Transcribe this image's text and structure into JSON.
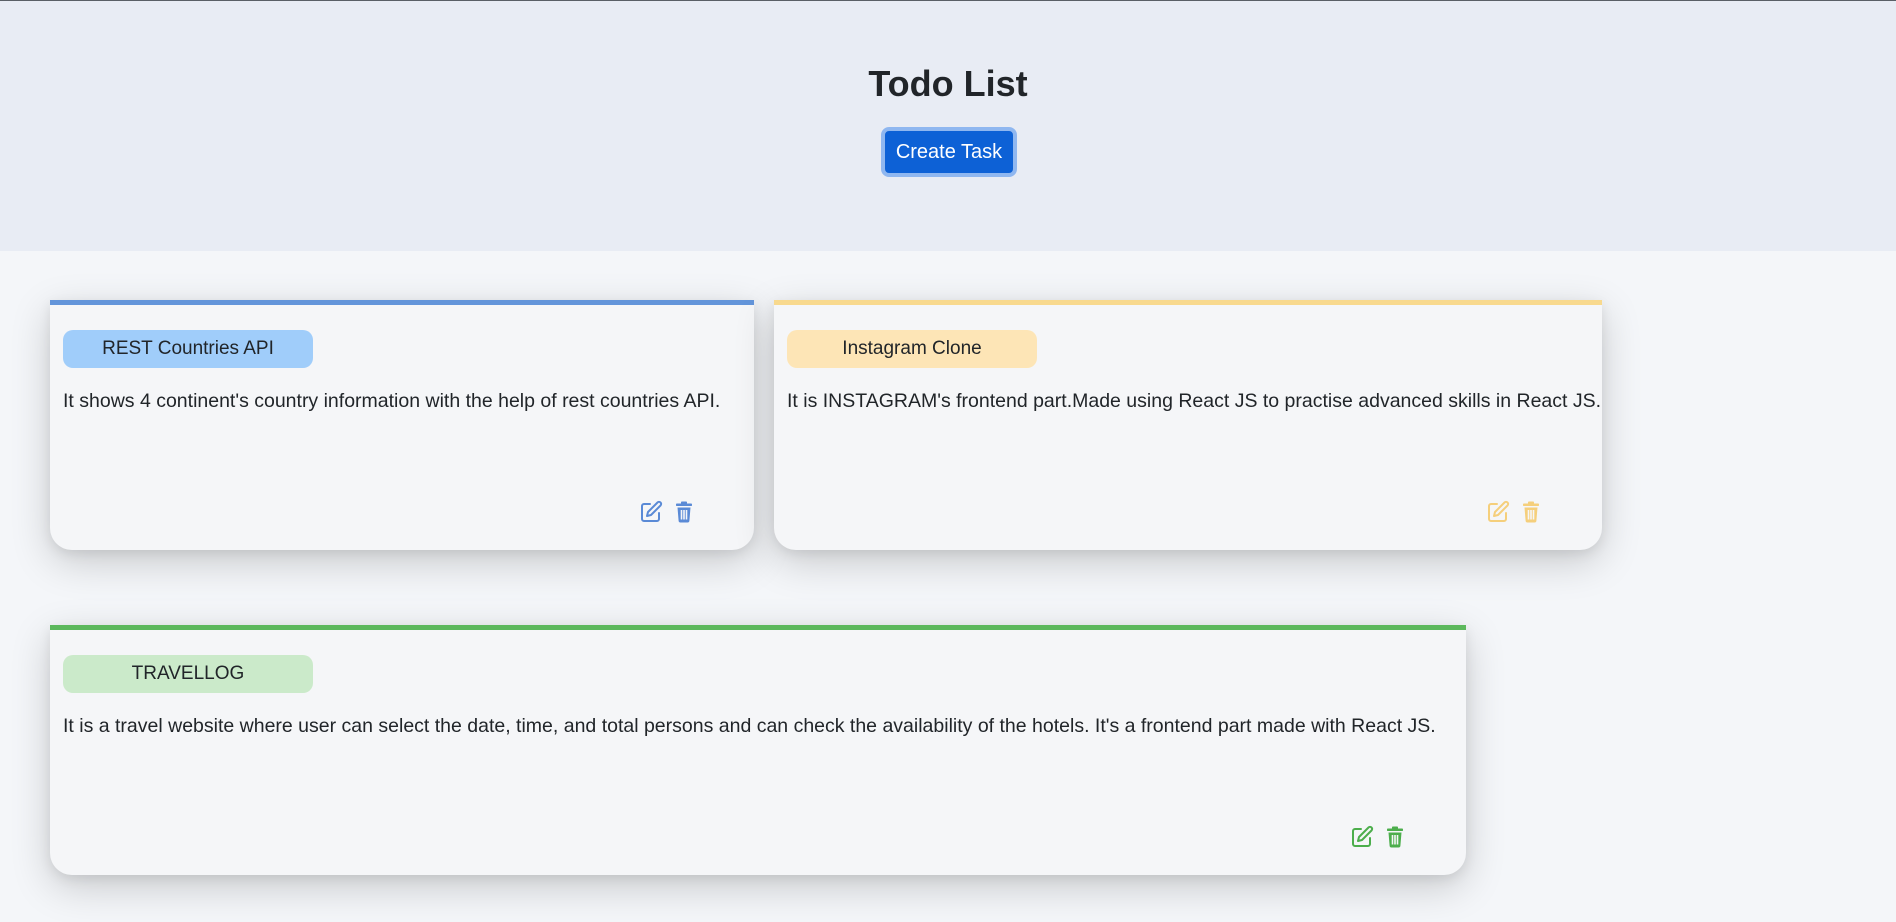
{
  "header": {
    "title": "Todo List",
    "create_button_label": "Create Task"
  },
  "tasks": [
    {
      "name": "REST Countries API",
      "description": "It shows 4 continent's country information with the help of rest countries API.",
      "accent_color": "#6395da",
      "badge_color": "#a0cdfa",
      "icon_color": "#5a8ad6",
      "actions": [
        "edit-icon",
        "trash-icon"
      ]
    },
    {
      "name": "Instagram Clone",
      "description": "It is INSTAGRAM's frontend part.Made using React JS to practise advanced skills in React JS.",
      "accent_color": "#f8d98e",
      "badge_color": "#fde5b6",
      "icon_color": "#f5cf7c",
      "actions": [
        "edit-icon",
        "trash-icon"
      ]
    },
    {
      "name": "TRAVELLOG",
      "description": "It is a travel website where user can select the date, time, and total persons and can check the availability of the hotels. It's a frontend part made with React JS.",
      "accent_color": "#5cb85c",
      "badge_color": "#cbeaca",
      "icon_color": "#4cae4c",
      "actions": [
        "edit-icon",
        "trash-icon"
      ]
    }
  ]
}
